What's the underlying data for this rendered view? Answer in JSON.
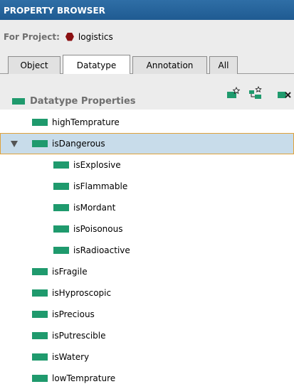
{
  "window": {
    "title": "PROPERTY BROWSER"
  },
  "project": {
    "label": "For Project:",
    "name": "logistics"
  },
  "tabs": [
    {
      "label": "Object"
    },
    {
      "label": "Datatype"
    },
    {
      "label": "Annotation"
    },
    {
      "label": "All"
    }
  ],
  "active_tab": "Datatype",
  "header": {
    "title": "Datatype Properties"
  },
  "colors": {
    "accent": "#1f9a6d",
    "title_bar": "#2a66a0",
    "project_icon": "#8b1012",
    "selection": "#c8dcea"
  },
  "tree": [
    {
      "label": "highTemprature"
    },
    {
      "label": "isDangerous"
    },
    {
      "label": "isExplosive"
    },
    {
      "label": "isFlammable"
    },
    {
      "label": "isMordant"
    },
    {
      "label": "isPoisonous"
    },
    {
      "label": "isRadioactive"
    },
    {
      "label": "isFragile"
    },
    {
      "label": "isHyproscopic"
    },
    {
      "label": "isPrecious"
    },
    {
      "label": "isPutrescible"
    },
    {
      "label": "isWatery"
    },
    {
      "label": "lowTemprature"
    }
  ]
}
